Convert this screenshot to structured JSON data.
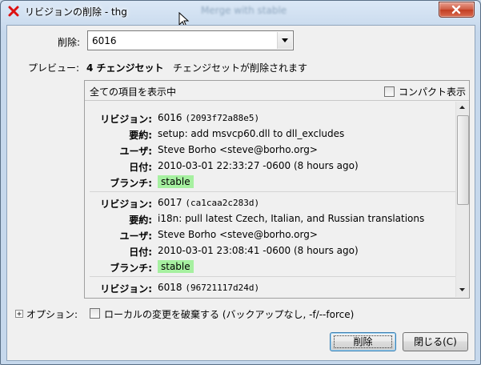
{
  "window": {
    "title": "リビジョンの削除 - thg",
    "ghost_title": "Merge with stable"
  },
  "form": {
    "revision_label": "削除:",
    "revision_value": "6016",
    "preview_label": "プレビュー:",
    "preview_count": "4 チェンジセット",
    "preview_suffix": "チェンジセットが削除されます"
  },
  "preview": {
    "header": "全ての項目を表示中",
    "compact_label": "コンパクト表示",
    "field_labels": {
      "revision": "リビジョン:",
      "summary": "要約:",
      "user": "ユーザ:",
      "date": "日付:",
      "branch": "ブランチ:"
    },
    "entries": [
      {
        "rev": "6016",
        "hash": "(2093f72a88e5)",
        "summary": "setup: add msvcp60.dll to dll_excludes",
        "user": "Steve Borho <steve@borho.org>",
        "date": "2010-03-01 22:33:27 -0600 (8 hours ago)",
        "branch": "stable"
      },
      {
        "rev": "6017",
        "hash": "(ca1caa2c283d)",
        "summary": "i18n: pull latest Czech, Italian, and Russian translations",
        "user": "Steve Borho <steve@borho.org>",
        "date": "2010-03-01 23:08:41 -0600 (8 hours ago)",
        "branch": "stable"
      },
      {
        "rev": "6018",
        "hash": "(96721117d24d)"
      }
    ]
  },
  "options": {
    "label": "オプション:",
    "discard_label": "ローカルの変更を破棄する (バックアップなし, -f/--force)"
  },
  "buttons": {
    "delete": "削除",
    "close": "閉じる(C)"
  },
  "colors": {
    "branch_badge": "#a6f0a0",
    "default_button_border": "#3c7fb1"
  }
}
